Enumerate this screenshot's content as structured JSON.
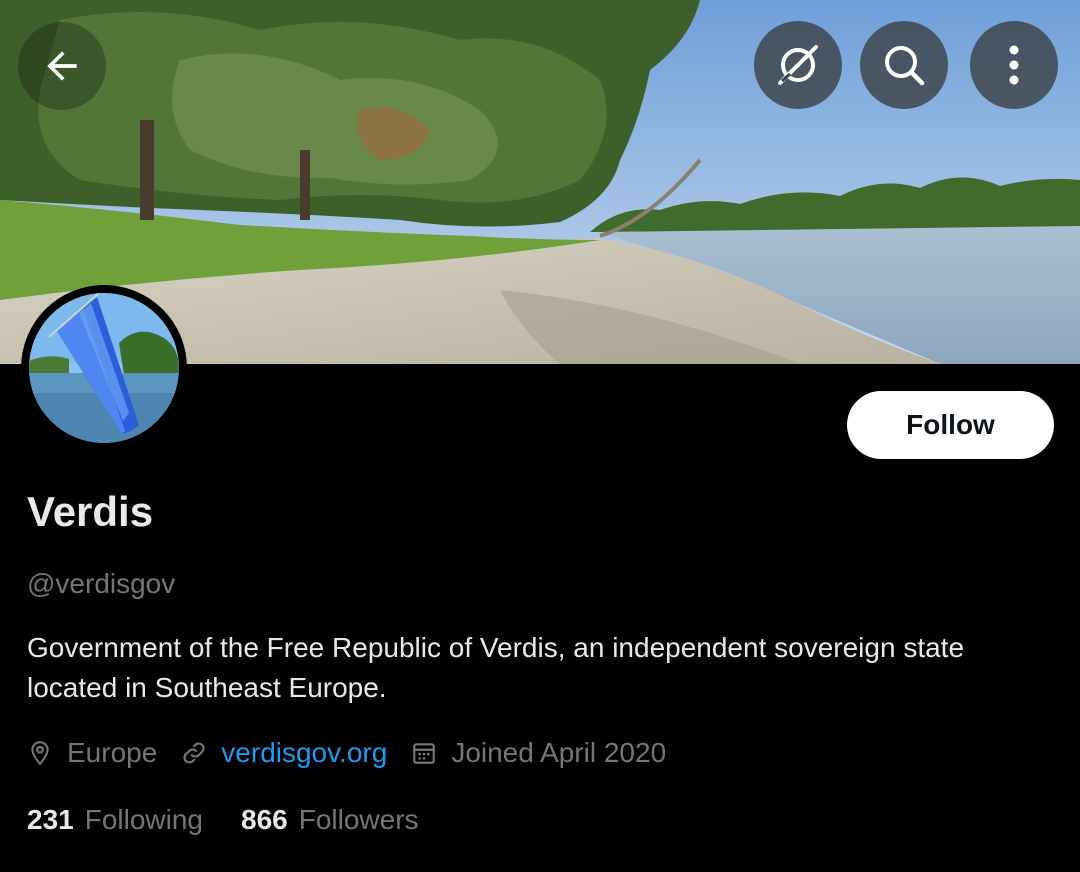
{
  "header": {
    "back_icon": "arrow-left-icon",
    "grok_icon": "grok-icon",
    "search_icon": "search-icon",
    "more_icon": "more-vertical-icon"
  },
  "profile": {
    "follow_label": "Follow",
    "display_name": "Verdis",
    "handle": "@verdisgov",
    "bio": "Government of the Free Republic of Verdis, an independent sovereign state located in Southeast Europe."
  },
  "meta": {
    "location": "Europe",
    "website": "verdisgov.org",
    "joined": "Joined April 2020"
  },
  "stats": {
    "following_count": "231",
    "following_label": "Following",
    "followers_count": "866",
    "followers_label": "Followers"
  },
  "colors": {
    "accent": "#1d9bf0",
    "secondary_text": "#71767b",
    "primary_text": "#e7e9ea",
    "background": "#000000"
  }
}
